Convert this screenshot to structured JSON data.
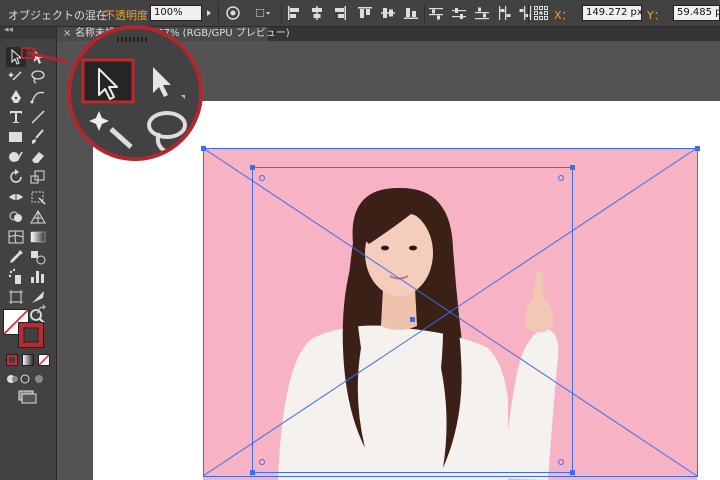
{
  "control_bar": {
    "object_label": "オブジェクトの混在",
    "opacity_label": "不透明度：",
    "opacity_value": "100%",
    "x_label": "X：",
    "x_value": "149.272 px",
    "y_label": "Y：",
    "y_value": "59.485 px"
  },
  "document_tab": {
    "close_glyph": "×",
    "title": "名称未設定 @ 66.67% (RGB/GPU プレビュー)"
  },
  "tools_panel": {
    "collapse_glyph": "◂◂",
    "fill_color": "#ffffff",
    "stroke_color": "#d0282e"
  },
  "colors": {
    "accent_red": "#c0272d",
    "selection_blue": "#3d6cf2",
    "photo_background": "#f7b3c3"
  }
}
